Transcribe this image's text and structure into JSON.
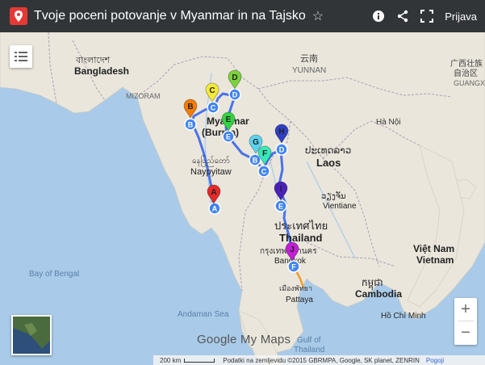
{
  "header": {
    "title": "Tvoje poceni potovanje v Myanmar in na Tajsko",
    "star": "☆",
    "signin_label": "Prijava"
  },
  "colors": {
    "route": "#4a73e8",
    "marker_blue": "#4285f4",
    "marker_A": "#e52929",
    "marker_B": "#f57c00",
    "marker_C": "#f4eb37",
    "marker_D": "#7cd23b",
    "marker_E": "#34d343",
    "marker_G": "#5bd3f0",
    "marker_F": "#36e8b7",
    "marker_H": "#2f3fc4",
    "marker_I": "#4a20b8",
    "marker_J": "#c21fd6"
  },
  "map": {
    "labels": [
      {
        "id": "bangladesh-bn",
        "text": "বাংলাদেশ"
      },
      {
        "id": "bangladesh",
        "text": "Bangladesh"
      },
      {
        "id": "mizoram",
        "text": "MIZORAM"
      },
      {
        "id": "yunnan-cn",
        "text": "云南"
      },
      {
        "id": "yunnan",
        "text": "YUNNAN"
      },
      {
        "id": "guangxi-cn",
        "text": "广西壮族"
      },
      {
        "id": "guangxi-cn2",
        "text": "自治区"
      },
      {
        "id": "guangxi",
        "text": "GUANGXI"
      },
      {
        "id": "myanmar",
        "text": "Myanmar"
      },
      {
        "id": "burma",
        "text": "(Burma)"
      },
      {
        "id": "hanoi",
        "text": "Hà Nội"
      },
      {
        "id": "laos-lo",
        "text": "ປະເທດລາວ"
      },
      {
        "id": "laos",
        "text": "Laos"
      },
      {
        "id": "naypyitaw-my",
        "text": "နေပြည်တော်"
      },
      {
        "id": "naypyitaw",
        "text": "Naypyitaw"
      },
      {
        "id": "vientiane-lo",
        "text": "ວຽງຈັນ"
      },
      {
        "id": "vientiane",
        "text": "Vientiane"
      },
      {
        "id": "thailand-th",
        "text": "ประเทศไทย"
      },
      {
        "id": "thailand",
        "text": "Thailand"
      },
      {
        "id": "bangkok-th",
        "text": "กรุงเทพมหานคร"
      },
      {
        "id": "bangkok",
        "text": "Bangkok"
      },
      {
        "id": "vietnam",
        "text": "Việt Nam"
      },
      {
        "id": "vietnam2",
        "text": "Vietnam"
      },
      {
        "id": "bay-of-bengal",
        "text": "Bay of Bengal"
      },
      {
        "id": "cambodia-km",
        "text": "កម្ពុជា"
      },
      {
        "id": "cambodia",
        "text": "Cambodia"
      },
      {
        "id": "pattaya-th",
        "text": "เมืองพัทยา"
      },
      {
        "id": "pattaya",
        "text": "Pattaya"
      },
      {
        "id": "hcmc",
        "text": "Hồ Chí Minh"
      },
      {
        "id": "andaman",
        "text": "Andaman Sea"
      },
      {
        "id": "gulf-of",
        "text": "Gulf of"
      },
      {
        "id": "thailand-gulf",
        "text": "Thailand"
      }
    ],
    "markers": [
      {
        "id": "A",
        "letter": "A",
        "color_key": "marker_A"
      },
      {
        "id": "B",
        "letter": "B",
        "color_key": "marker_B"
      },
      {
        "id": "C",
        "letter": "C",
        "color_key": "marker_C"
      },
      {
        "id": "D",
        "letter": "D",
        "color_key": "marker_D"
      },
      {
        "id": "E",
        "letter": "E",
        "color_key": "marker_E"
      },
      {
        "id": "G",
        "letter": "G",
        "color_key": "marker_G"
      },
      {
        "id": "F",
        "letter": "F",
        "color_key": "marker_F"
      },
      {
        "id": "H",
        "letter": "H",
        "color_key": "marker_H"
      },
      {
        "id": "I",
        "letter": "I",
        "color_key": "marker_I"
      },
      {
        "id": "J",
        "letter": "J",
        "color_key": "marker_J"
      }
    ],
    "dots": [
      {
        "id": "d-A",
        "letter": "A"
      },
      {
        "id": "d-B",
        "letter": "B"
      },
      {
        "id": "d-C1",
        "letter": "C"
      },
      {
        "id": "d-D1",
        "letter": "D"
      },
      {
        "id": "d-E1",
        "letter": "E"
      },
      {
        "id": "d-B2",
        "letter": "B"
      },
      {
        "id": "d-C2",
        "letter": "C"
      },
      {
        "id": "d-D2",
        "letter": "D"
      },
      {
        "id": "d-E2",
        "letter": "E"
      },
      {
        "id": "d-F",
        "letter": "F"
      }
    ]
  },
  "controls": {
    "zoom_in": "+",
    "zoom_out": "−"
  },
  "watermark": "Google My Maps",
  "footer": {
    "scale_label": "200 km",
    "attribution": "Podatki na zemljevidu ©2015 GBRMPA, Google, SK planet, ZENRIN",
    "terms": "Pogoji"
  }
}
